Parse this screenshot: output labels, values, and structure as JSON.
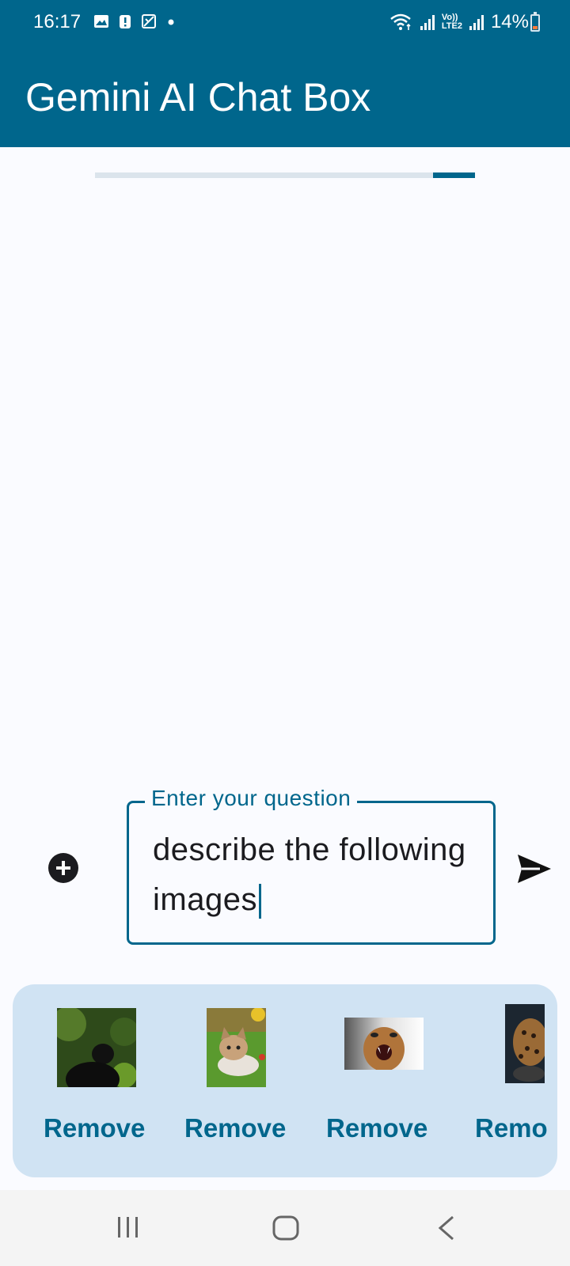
{
  "status_bar": {
    "time": "16:17",
    "battery": "14%",
    "network_label_top": "Vo))",
    "network_label_bottom": "LTE2",
    "left_icons": [
      "gallery-icon",
      "alert-icon",
      "no-sync-icon",
      "dot-icon"
    ],
    "right_icons": [
      "wifi-icon",
      "signal-icon",
      "signal-icon",
      "battery-icon"
    ]
  },
  "app_bar": {
    "title": "Gemini AI Chat Box"
  },
  "loading": {
    "progress": 0.11
  },
  "input": {
    "label": "Enter your question",
    "value": "describe the following images"
  },
  "actions": {
    "add_icon": "add-circle-icon",
    "send_icon": "send-icon"
  },
  "images": [
    {
      "subject": "monkey",
      "remove_label": "Remove"
    },
    {
      "subject": "kitten",
      "remove_label": "Remove"
    },
    {
      "subject": "cougar",
      "remove_label": "Remove"
    },
    {
      "subject": "jaguar",
      "remove_label": "Remo"
    }
  ],
  "nav": {
    "icons": [
      "recents-icon",
      "home-icon",
      "back-icon"
    ]
  },
  "colors": {
    "primary": "#00668c",
    "strip_background": "#d0e3f3",
    "page_background": "#fafbff"
  }
}
